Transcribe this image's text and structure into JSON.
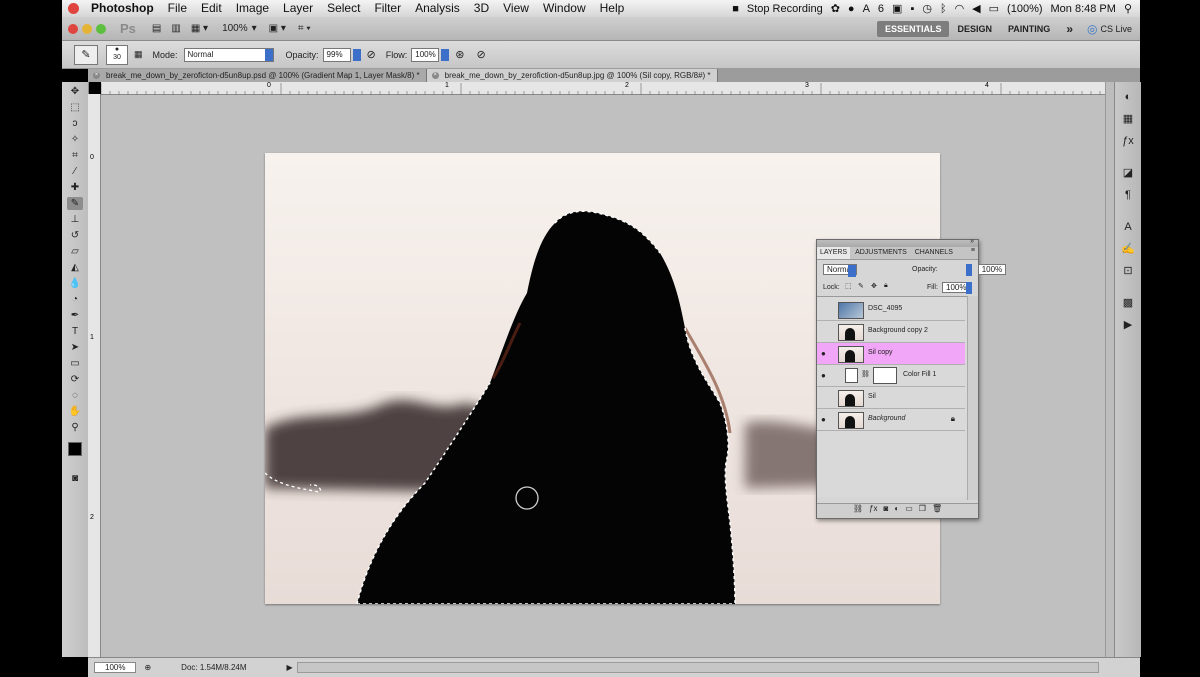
{
  "menubar": {
    "app": "Photoshop",
    "items": [
      "File",
      "Edit",
      "Image",
      "Layer",
      "Select",
      "Filter",
      "Analysis",
      "3D",
      "View",
      "Window",
      "Help"
    ],
    "stop_recording": "Stop Recording",
    "battery": "(100%)",
    "clock": "Mon 8:48 PM",
    "ai_count": "6"
  },
  "appbar": {
    "ps_logo": "Ps",
    "zoom": "100%",
    "workspaces": [
      "ESSENTIALS",
      "DESIGN",
      "PAINTING"
    ],
    "more": "»",
    "cslive": "CS Live"
  },
  "options": {
    "brush_size": "30",
    "mode_label": "Mode:",
    "mode_value": "Normal",
    "opacity_label": "Opacity:",
    "opacity_value": "99%",
    "flow_label": "Flow:",
    "flow_value": "100%"
  },
  "tabs": [
    {
      "label": "break_me_down_by_zeroficton-d5un8up.psd @ 100% (Gradient Map 1, Layer Mask/8) *"
    },
    {
      "label": "break_me_down_by_zerofiction-d5un8up.jpg @ 100% (Sil copy, RGB/8#) *"
    }
  ],
  "ruler": {
    "h_ticks": [
      "0",
      "1",
      "2",
      "3",
      "4"
    ],
    "v_ticks": [
      "0",
      "1",
      "2"
    ]
  },
  "status": {
    "zoom": "100%",
    "doc": "Doc: 1.54M/8.24M"
  },
  "layers_panel": {
    "tabs": [
      "LAYERS",
      "ADJUSTMENTS",
      "CHANNELS"
    ],
    "blend_mode": "Normal",
    "opacity_label": "Opacity:",
    "opacity_value": "100%",
    "lock_label": "Lock:",
    "fill_label": "Fill:",
    "fill_value": "100%",
    "layers": [
      {
        "name": "DSC_4095",
        "visible": false,
        "selected": false
      },
      {
        "name": "Background copy 2",
        "visible": false,
        "selected": false
      },
      {
        "name": "Sil copy",
        "visible": true,
        "selected": true
      },
      {
        "name": "Color Fill 1",
        "visible": true,
        "selected": false
      },
      {
        "name": "Sil",
        "visible": false,
        "selected": false
      },
      {
        "name": "Background",
        "visible": true,
        "selected": false
      }
    ]
  },
  "colors": {
    "selected_layer": "#f2a6f7",
    "active_workspace": "#7d7d7d",
    "canvas_bg": "#c0c0c0"
  }
}
